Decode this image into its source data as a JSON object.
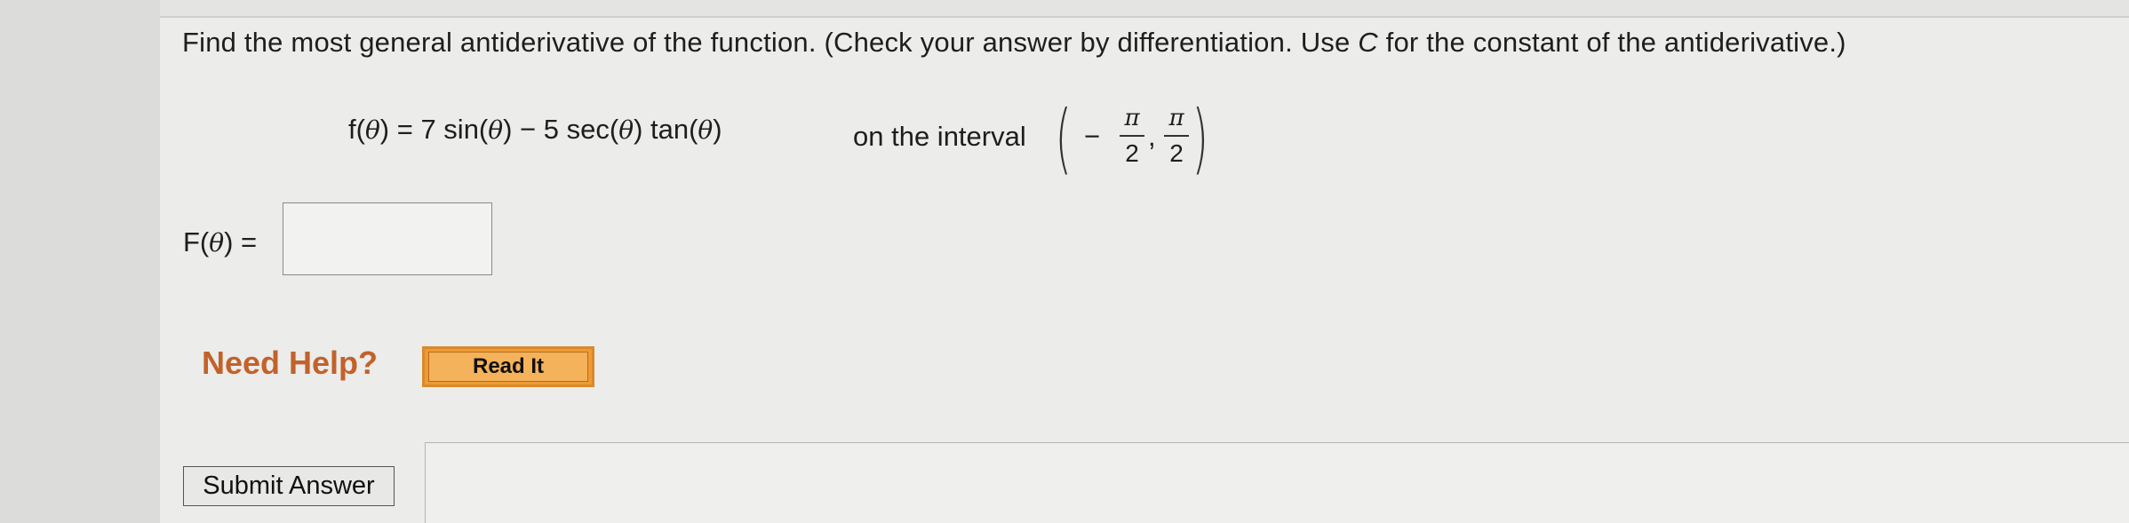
{
  "question": {
    "text_before_c": "Find the most general antiderivative of the function. (Check your answer by differentiation. Use ",
    "c_var": "C",
    "text_after_c": " for the constant of the antiderivative.)"
  },
  "function": {
    "f_lhs": "f(",
    "theta": "θ",
    "f_rhs_1": ") = 7 sin(",
    "f_rhs_2": ") − 5 sec(",
    "f_rhs_3": ") tan(",
    "f_rhs_4": ")",
    "interval_label": "on the interval",
    "interval": {
      "open_paren": "(",
      "close_paren": ")",
      "minus": "−",
      "pi": "π",
      "den": "2",
      "comma": ","
    }
  },
  "answer": {
    "label_lhs": "F(",
    "label_rhs": ") =",
    "value": ""
  },
  "help": {
    "label": "Need Help?",
    "read_it_button": "Read It"
  },
  "submit": {
    "label": "Submit Answer"
  },
  "colors": {
    "need_help": "#c2622a",
    "read_it_bg": "#f09a34",
    "page_bg": "#ececea"
  }
}
